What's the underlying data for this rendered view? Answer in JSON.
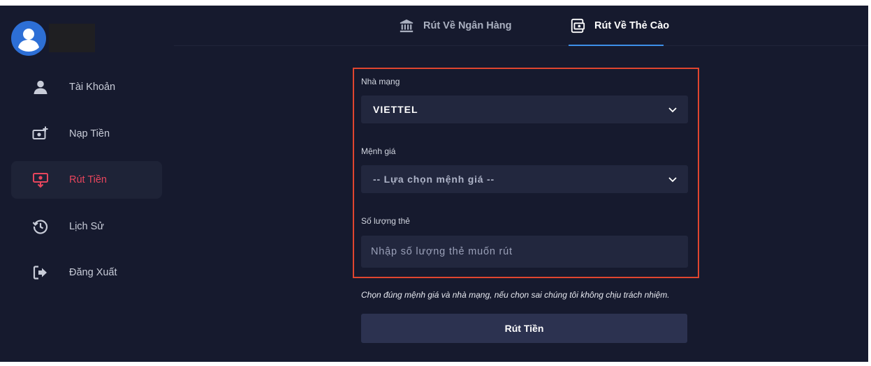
{
  "user": {
    "avatar_icon": "user-avatar-icon",
    "avatar_color": "#2d6fd6"
  },
  "sidebar": {
    "items": [
      {
        "label": "Tài Khoản",
        "icon": "user-icon",
        "active": false
      },
      {
        "label": "Nạp Tiền",
        "icon": "cash-plus-icon",
        "active": false
      },
      {
        "label": "Rút Tiền",
        "icon": "withdraw-icon",
        "active": true
      },
      {
        "label": "Lịch Sử",
        "icon": "history-icon",
        "active": false
      },
      {
        "label": "Đăng Xuất",
        "icon": "logout-icon",
        "active": false
      }
    ]
  },
  "tabs": [
    {
      "label": "Rút Về Ngân Hàng",
      "icon": "bank-icon",
      "active": false
    },
    {
      "label": "Rút Về Thẻ Cào",
      "icon": "card-withdraw-icon",
      "active": true
    }
  ],
  "form": {
    "carrier": {
      "label": "Nhà mạng",
      "value": "VIETTEL"
    },
    "denomination": {
      "label": "Mệnh giá",
      "value": "-- Lựa chọn mệnh giá --"
    },
    "quantity": {
      "label": "Số lượng thẻ",
      "placeholder": "Nhập số lượng thẻ muốn rút"
    },
    "note": "Chọn đúng mệnh giá và nhà mạng, nếu chọn sai chúng tôi không chịu trách nhiệm.",
    "submit_label": "Rút Tiền"
  },
  "colors": {
    "background": "#161a2e",
    "accent": "#3d8fe8",
    "active_nav": "#e8455d",
    "highlight_border": "#e0452f"
  }
}
